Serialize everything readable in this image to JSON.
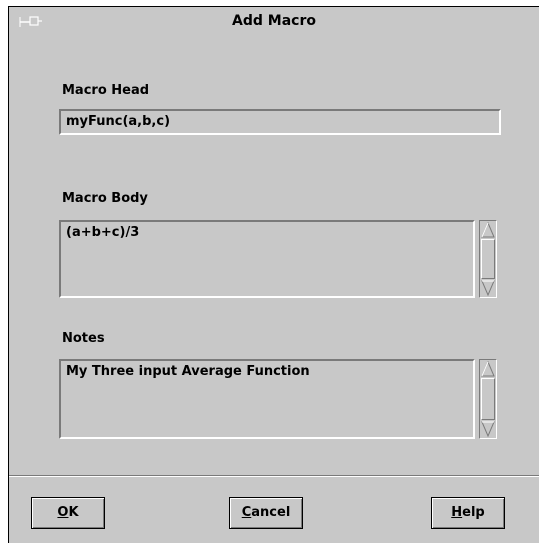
{
  "window": {
    "title": "Add Macro",
    "icon": "pin-icon"
  },
  "macro_head": {
    "label": "Macro Head",
    "value": "myFunc(a,b,c)"
  },
  "macro_body": {
    "label": "Macro Body",
    "value": "(a+b+c)/3"
  },
  "notes": {
    "label": "Notes",
    "value": "My Three input Average Function"
  },
  "buttons": {
    "ok": {
      "mnemonic": "O",
      "rest": "K"
    },
    "cancel": {
      "mnemonic": "C",
      "rest": "ancel"
    },
    "help": {
      "mnemonic": "H",
      "rest": "elp"
    }
  }
}
